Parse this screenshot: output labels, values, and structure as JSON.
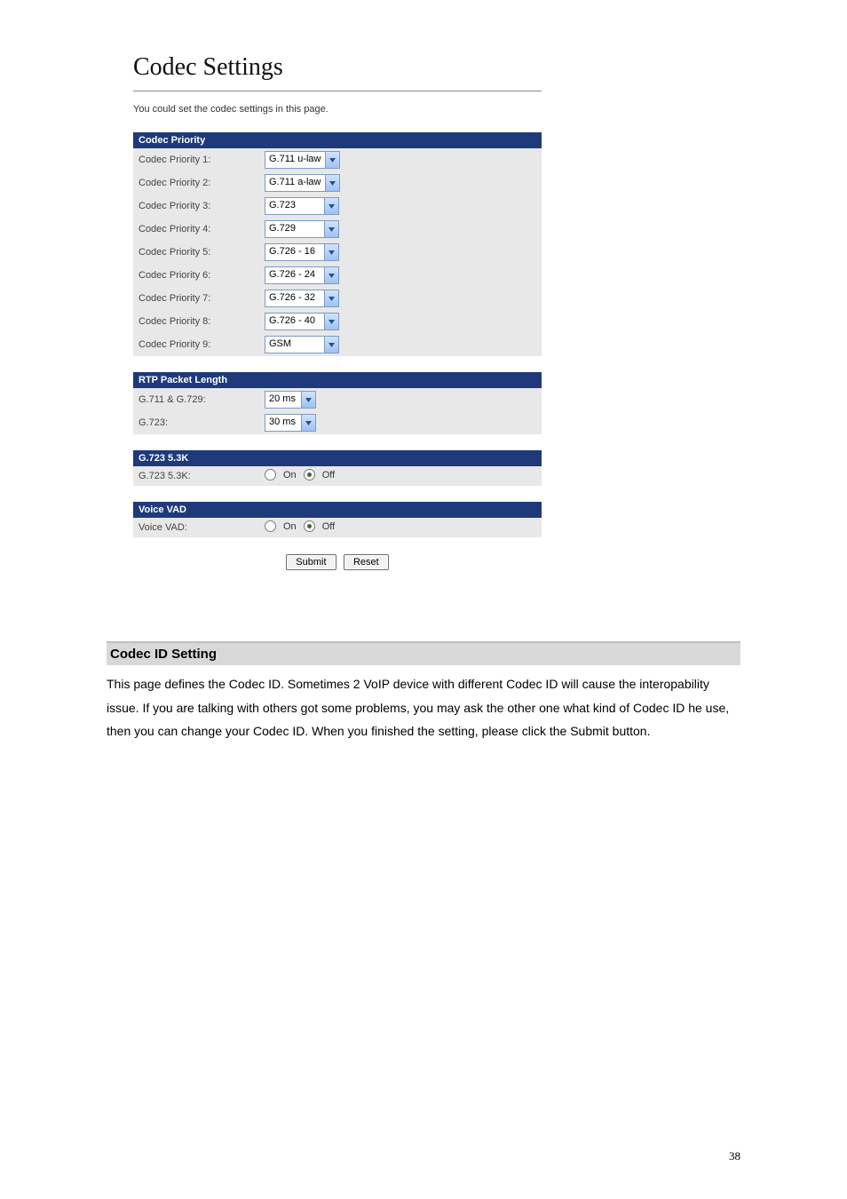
{
  "page": {
    "title": "Codec Settings",
    "intro": "You could set the codec settings in this page.",
    "page_number": "38"
  },
  "codec_priority": {
    "header": "Codec Priority",
    "rows": [
      {
        "label": "Codec Priority 1:",
        "value": "G.711 u-law"
      },
      {
        "label": "Codec Priority 2:",
        "value": "G.711 a-law"
      },
      {
        "label": "Codec Priority 3:",
        "value": "G.723"
      },
      {
        "label": "Codec Priority 4:",
        "value": "G.729"
      },
      {
        "label": "Codec Priority 5:",
        "value": "G.726 - 16"
      },
      {
        "label": "Codec Priority 6:",
        "value": "G.726 - 24"
      },
      {
        "label": "Codec Priority 7:",
        "value": "G.726 - 32"
      },
      {
        "label": "Codec Priority 8:",
        "value": "G.726 - 40"
      },
      {
        "label": "Codec Priority 9:",
        "value": "GSM"
      }
    ]
  },
  "rtp": {
    "header": "RTP Packet Length",
    "rows": [
      {
        "label": "G.711 & G.729:",
        "value": "20 ms"
      },
      {
        "label": "G.723:",
        "value": "30 ms"
      }
    ]
  },
  "g723_53k": {
    "header": "G.723 5.3K",
    "label": "G.723 5.3K:",
    "on": "On",
    "off": "Off"
  },
  "voice_vad": {
    "header": "Voice VAD",
    "label": "Voice VAD:",
    "on": "On",
    "off": "Off"
  },
  "buttons": {
    "submit": "Submit",
    "reset": "Reset"
  },
  "doc": {
    "heading": "Codec ID Setting",
    "body": "This page defines the Codec ID. Sometimes 2 VoIP device with different Codec ID will cause the interopability issue. If you are talking with others got some problems, you may ask the other one what kind of Codec ID he use, then you can change your Codec ID. When you finished the setting, please click the Submit button."
  }
}
